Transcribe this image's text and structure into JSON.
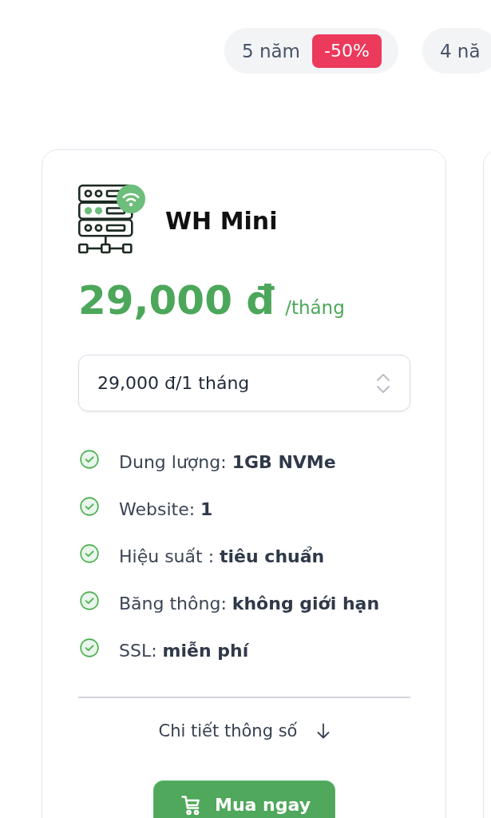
{
  "duration_tabs": [
    {
      "label": "5 năm",
      "badge": "-50%",
      "selected": false
    },
    {
      "label": "4 nă",
      "selected": false
    }
  ],
  "plans": [
    {
      "kind": "full",
      "name": "WH Mini",
      "price": "29,000 đ",
      "period": "/tháng",
      "billing_select": {
        "value": "29,000 đ/1 tháng"
      },
      "features": [
        "Dung lượng: **1GB NVMe**",
        "Website: **1**",
        "Hiệu suất : **tiêu chuẩn**",
        "Băng thông: **không giới hạn**",
        "SSL: **miễn phí**"
      ],
      "details_link": "Chi tiết thông số",
      "buy_button": "Mua ngay"
    },
    {
      "kind": "edge"
    }
  ]
}
